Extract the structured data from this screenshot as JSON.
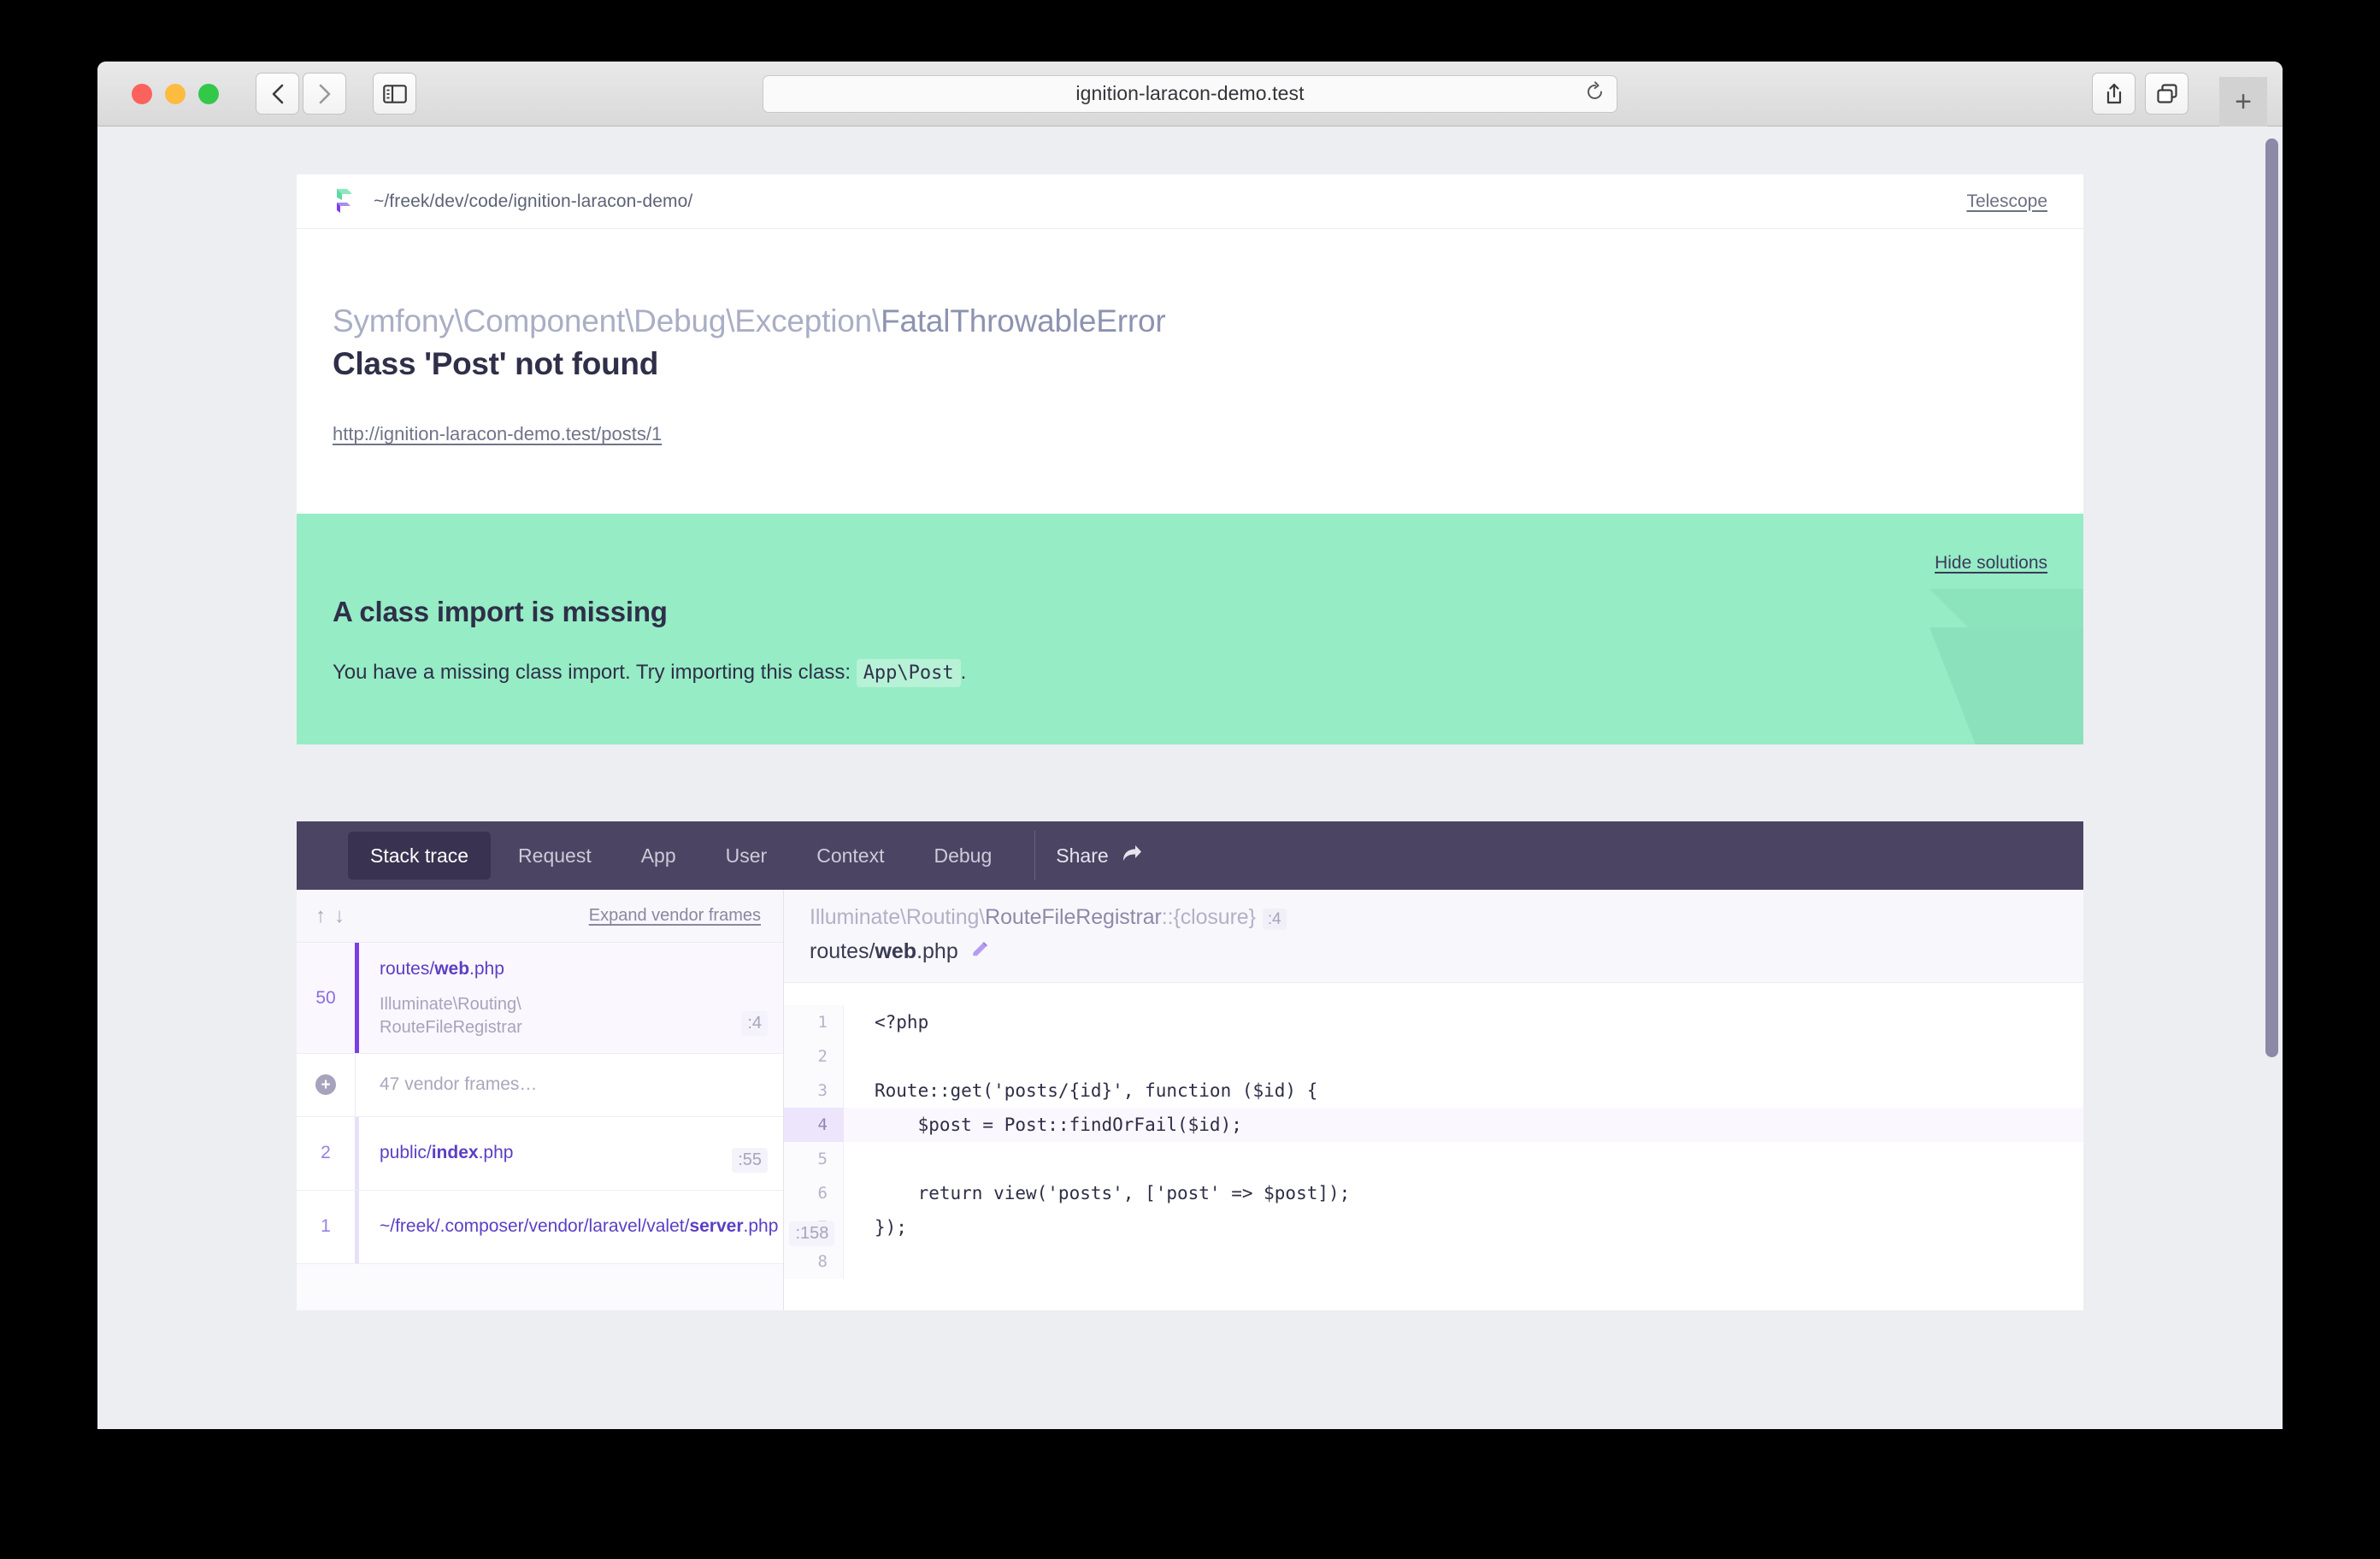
{
  "browser": {
    "url_text": "ignition-laracon-demo.test",
    "back_label": "Back",
    "forward_label": "Forward",
    "sidebar_label": "Show sidebar",
    "reload_label": "Reload",
    "share_label": "Share",
    "tabs_label": "Show tabs",
    "newtab_label": "+"
  },
  "header": {
    "path": "~/freek/dev/code/ignition-laracon-demo/",
    "telescope_label": "Telescope"
  },
  "error": {
    "class_prefix": "Symfony\\Component\\Debug\\Exception\\",
    "class_name": "FatalThrowableError",
    "message": "Class 'Post' not found",
    "url": "http://ignition-laracon-demo.test/posts/1"
  },
  "solution": {
    "hide_label": "Hide solutions",
    "title": "A class import is missing",
    "text_before": "You have a missing class import. Try importing this class:",
    "code": "App\\Post",
    "text_after": "."
  },
  "tabs": [
    {
      "label": "Stack trace",
      "active": true
    },
    {
      "label": "Request",
      "active": false
    },
    {
      "label": "App",
      "active": false
    },
    {
      "label": "User",
      "active": false
    },
    {
      "label": "Context",
      "active": false
    },
    {
      "label": "Debug",
      "active": false
    }
  ],
  "share": {
    "label": "Share",
    "icon": "share-arrow-icon"
  },
  "frames_panel": {
    "sort_up": "↑",
    "sort_down": "↓",
    "expand_vendor_label": "Expand vendor frames",
    "frames": [
      {
        "number": "50",
        "file_dir": "routes/",
        "file_name": "web",
        "file_ext": ".php",
        "class": "Illuminate\\Routing\\\nRouteFileRegistrar",
        "line": ":4",
        "selected": true,
        "vendor": false
      },
      {
        "number": "",
        "file_dir": "",
        "file_name": "",
        "file_ext": "",
        "label": "47 vendor frames…",
        "class": "",
        "line": "",
        "selected": false,
        "vendor": true
      },
      {
        "number": "2",
        "file_dir": "public/",
        "file_name": "index",
        "file_ext": ".php",
        "class": "",
        "line": ":55",
        "selected": false,
        "vendor": false
      },
      {
        "number": "1",
        "file_dir": "~/freek/.composer/vendor/laravel/valet/",
        "file_name": "server",
        "file_ext": ".php",
        "class": "",
        "line": ":158",
        "selected": false,
        "vendor": false
      }
    ]
  },
  "code_panel": {
    "class_prefix": "Illuminate\\Routing\\",
    "class_name": "RouteFileRegistrar",
    "class_suffix": "::{closure}",
    "line_badge": ":4",
    "file_dir": "routes/",
    "file_name": "web",
    "file_ext": ".php",
    "edit_icon": "pencil-icon",
    "lines": [
      {
        "n": "1",
        "text": "<?php",
        "highlight": false
      },
      {
        "n": "2",
        "text": "",
        "highlight": false
      },
      {
        "n": "3",
        "text": "Route::get('posts/{id}', function ($id) {",
        "highlight": false
      },
      {
        "n": "4",
        "text": "    $post = Post::findOrFail($id);",
        "highlight": true
      },
      {
        "n": "5",
        "text": "",
        "highlight": false
      },
      {
        "n": "6",
        "text": "    return view('posts', ['post' => $post]);",
        "highlight": false
      },
      {
        "n": "7",
        "text": "});",
        "highlight": false
      },
      {
        "n": "8",
        "text": "",
        "highlight": false
      }
    ]
  },
  "colors": {
    "solution_green": "#96ecc5",
    "tabbar_purple": "#4b4463",
    "accent_purple": "#7b3fe4",
    "page_bg": "#edeef2"
  }
}
